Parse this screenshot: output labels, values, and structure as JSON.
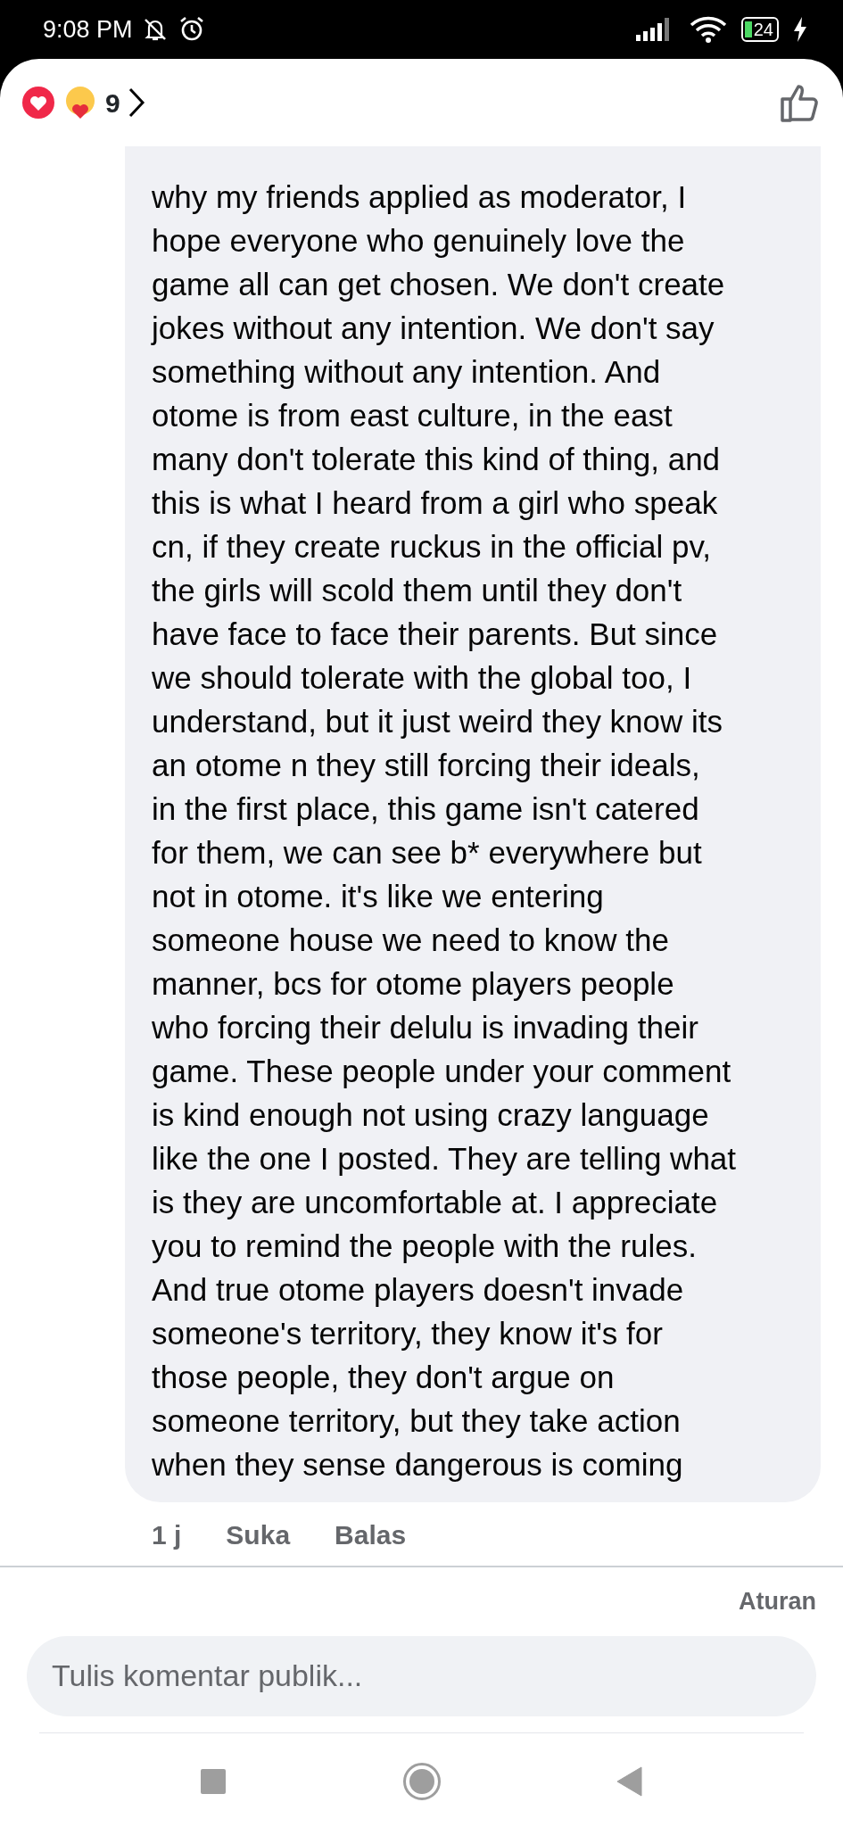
{
  "status_bar": {
    "time": "9:08 PM",
    "battery": "24"
  },
  "header": {
    "reaction_count": "9"
  },
  "comment": {
    "text": "why my friends applied as moderator, I\nhope everyone who genuinely love the\ngame all can get chosen. We don't create\njokes without any intention. We don't say\nsomething without any intention. And\notome is from east culture, in the east\nmany don't tolerate this kind of thing, and\nthis is what I heard from a girl who speak\ncn, if they create ruckus in the official pv,\nthe girls will scold them until they don't\nhave face to face their parents. But since\nwe should tolerate with the global too, I\nunderstand, but it just weird they know its\nan otome n they still forcing their ideals,\nin the first place, this game isn't catered\nfor them, we can see b* everywhere but\nnot in otome. it's like we entering\nsomeone house we need to know the\nmanner, bcs for otome players people\nwho forcing their delulu is invading their\ngame. These people under your comment\nis kind enough not using crazy language\nlike the one I posted. They are telling what\nis they are uncomfortable at. I appreciate\nyou to remind the people with the rules.\nAnd true otome players doesn't invade\nsomeone's territory, they know it's for\nthose people, they don't argue on\nsomeone territory, but they take action\nwhen they sense dangerous is coming",
    "time": "1 j",
    "actions": [
      "Suka",
      "Balas"
    ]
  },
  "rules_link": "Aturan",
  "composer": {
    "placeholder": "Tulis komentar publik..."
  }
}
